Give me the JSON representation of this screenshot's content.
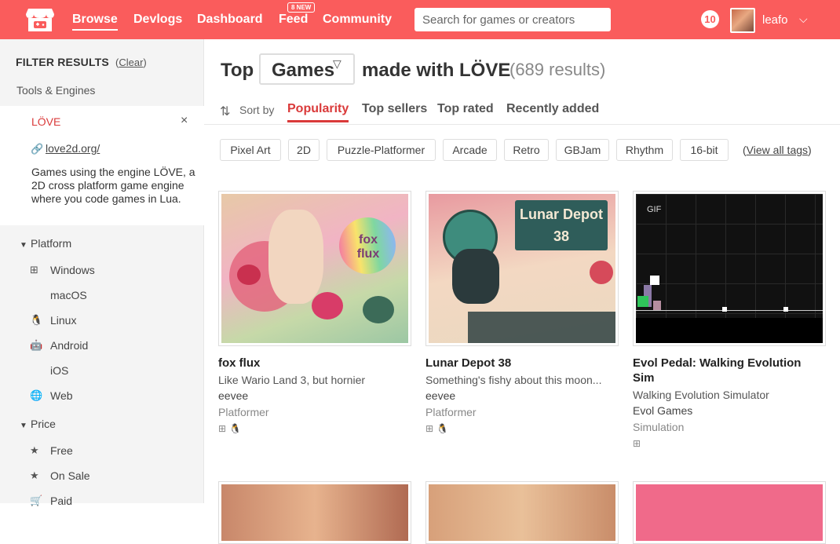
{
  "header": {
    "nav": [
      "Browse",
      "Devlogs",
      "Dashboard",
      "Feed",
      "Community"
    ],
    "feed_badge": "8 NEW",
    "search_placeholder": "Search for games or creators",
    "notifications": "10",
    "username": "leafo",
    "caret": "⌵"
  },
  "sidebar": {
    "title": "FILTER RESULTS",
    "clear": "Clear",
    "tools_section": "Tools & Engines",
    "engine": {
      "name": "LÖVE",
      "close": "×",
      "link": "love2d.org/",
      "desc": "Games using the engine LÖVE, a 2D cross platform game engine where you code games in Lua."
    },
    "platform_section": "Platform",
    "platforms": [
      "Windows",
      "macOS",
      "Linux",
      "Android",
      "iOS",
      "Web"
    ],
    "price_section": "Price",
    "prices": [
      "Free",
      "On Sale",
      "Paid"
    ]
  },
  "main": {
    "title_top": "Top",
    "title_dropdown": "Games",
    "title_rest": "made with LÖVE",
    "result_count": "(689 results)",
    "sort_label": "Sort by",
    "sort_tabs": [
      "Popularity",
      "Top sellers",
      "Top rated",
      "Recently added"
    ],
    "tags": [
      "Pixel Art",
      "2D",
      "Puzzle-Platformer",
      "Arcade",
      "Retro",
      "GBJam",
      "Rhythm",
      "16-bit"
    ],
    "view_all_tags": "View all tags"
  },
  "games": [
    {
      "title": "fox flux",
      "subtitle": "Like Wario Land 3, but hornier",
      "author": "eevee",
      "genre": "Platformer",
      "art_text": "fox flux",
      "platforms": [
        "windows-icon",
        "linux-icon",
        "apple-icon"
      ]
    },
    {
      "title": "Lunar Depot 38",
      "subtitle": "Something's fishy about this moon...",
      "author": "eevee",
      "genre": "Platformer",
      "art_text": "Lunar Depot 38",
      "platforms": [
        "windows-icon",
        "linux-icon",
        "apple-icon"
      ]
    },
    {
      "title": "Evol Pedal: Walking Evolution Sim",
      "subtitle": "Walking Evolution Simulator",
      "author": "Evol Games",
      "genre": "Simulation",
      "art_badge": "GIF",
      "platforms": [
        "windows-icon",
        "apple-icon"
      ]
    }
  ],
  "colors": {
    "accent": "#fa5c5c",
    "link_red": "#da3a3a"
  }
}
